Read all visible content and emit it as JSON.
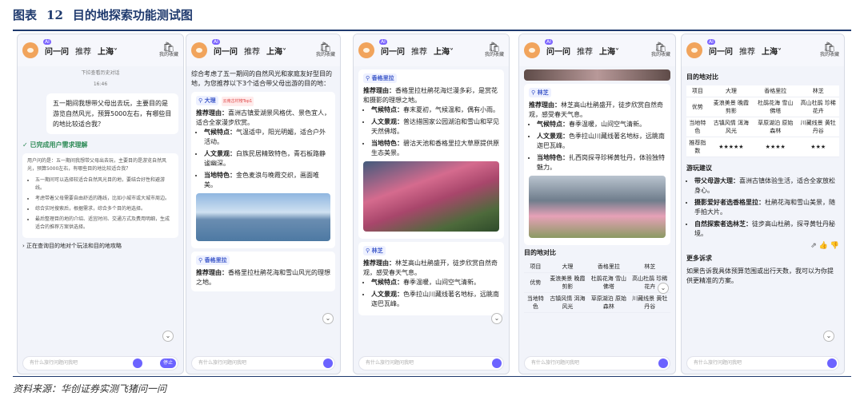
{
  "figure": {
    "label": "图表",
    "number": "12",
    "title": "目的地探索功能测试图",
    "source": "资料来源：华创证券实测飞猪问一问"
  },
  "header": {
    "ai_badge": "AI",
    "tab_ask": "问一问",
    "tab_recommend": "推荐",
    "city": "上海",
    "fav_label": "我的收藏",
    "fav_icon": "bookmark-icon"
  },
  "input": {
    "placeholder": "有什么旅行问题问我吧",
    "stop_label": "停止"
  },
  "p1": {
    "history_link": "下拉查看历史对话",
    "time": "16:46",
    "user_msg": "五一期间我想带父母出去玩，主要目的是游览自然风光，预算5000左右，有哪些目的地比较适合我？",
    "done_label": "已完成用户需求理解",
    "analysis": "用户问的是：五一期间我想带父母出去玩，主要目的是游览自然风光，预算5000左右，有哪些目的地比较适合我？",
    "bullets": [
      "五一期间可以选择较适合自然风光目的地，要结合好性和避游线。",
      "考虑带着父母需要自由舒适的路线，比如小城市或大城市周边。",
      "综合实时搜索后，根据需求，综合多个目的地选择。",
      "最后整理目的地的介绍、适宜时间、交通方式及费用明细，生成适合的推荐方案供选择。"
    ],
    "querying": "正在查询目的地对个玩法和目的地攻略"
  },
  "p2": {
    "intro": "综合考虑了五一期间的自然风光和家庭友好型目的地，为您推荐以下3个适合带父母出游的目的地：",
    "dest1": "大理",
    "dest1_badge": "云南古村榜Top1",
    "reason_label": "推荐理由：",
    "reason1": "喜洲古镇爱湖景风格优、景色宜人，适合全家漫步欣赏。",
    "climate_label": "气候特点：",
    "climate1": "气温适中，阳光明媚，适合户外活动。",
    "culture_label": "人文景观：",
    "culture1": "白族民居精致特色，青石板路静谧幽深。",
    "local_label": "当地特色：",
    "local1": "金色麦浪与晚霞交织，画面唯美。",
    "dest2": "香格里拉",
    "reason2": "香格里拉杜鹃花海和雪山风光的理想之地。"
  },
  "p3": {
    "dest1": "香格里拉",
    "reason1": "香格里拉杜鹃花海烂漫多彩，是赏花和摄影的理想之地。",
    "climate1": "春末夏初，气候温和，偶有小雨。",
    "culture1": "普达措国家公园湖泊和雪山和罕见天然佛塔。",
    "local1": "碧沽天池和香格里拉大草原提供原生态美景。",
    "dest2": "林芝",
    "reason2": "林芝高山杜鹃盛开，徒步欣赏自然奇观，感受春天气息。",
    "climate2": "春季温暖，山间空气清新。",
    "culture2": "色季拉山川藏线著名地标，远眺南迦巴瓦峰。"
  },
  "p4": {
    "dest": "林芝",
    "reason": "林芝高山杜鹃盛开，徒步欣赏自然奇观，感受春天气息。",
    "climate": "春季温暖，山间空气清新。",
    "culture": "色季拉山川藏线著名地标，远眺南迦巴瓦峰。",
    "local": "扎西岗探寻珍稀黄牡丹，体验独特魅力。",
    "compare_title": "目的地对比"
  },
  "compare": {
    "headers": [
      "项目",
      "大理",
      "香格里拉",
      "林芝"
    ],
    "rows": [
      [
        "优势",
        "麦浪美景 晚霞剪影",
        "杜鹃花海 雪山佛塔",
        "高山杜鹃 珍稀花卉"
      ],
      [
        "当地特色",
        "古镇风情 洱海风光",
        "草原湖泊 原始森林",
        "川藏线景 黄牡丹谷"
      ],
      [
        "推荐指数",
        "★★★★★",
        "★★★★",
        "★★★"
      ]
    ]
  },
  "p5": {
    "compare_title": "目的地对比",
    "tips_title": "游玩建议",
    "tips": [
      {
        "bold": "带父母游大理：",
        "text": "喜洲古镇体验生活，适合全家放松身心。"
      },
      {
        "bold": "摄影爱好者选香格里拉：",
        "text": "杜鹃花海和雪山美景，随手拍大片。"
      },
      {
        "bold": "自然探索者选林芝：",
        "text": "徒步高山杜鹃，探寻黄牡丹秘境。"
      }
    ],
    "more_title": "更多诉求",
    "more_text": "如果告诉我具体预算范围或出行天数，我可以为你提供更精准的方案。"
  }
}
